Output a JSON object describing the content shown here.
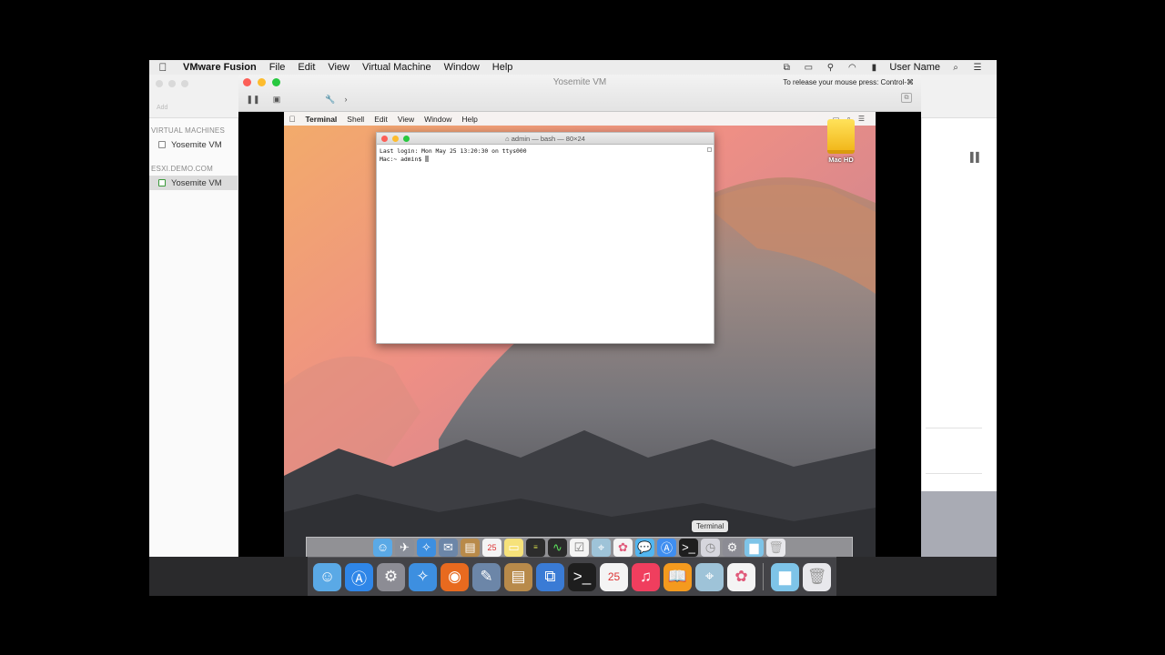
{
  "host_menubar": {
    "app": "VMware Fusion",
    "menus": [
      "File",
      "Edit",
      "View",
      "Virtual Machine",
      "Window",
      "Help"
    ],
    "user": "User Name"
  },
  "library": {
    "add_label": "Add",
    "sections": [
      {
        "heading": "VIRTUAL MACHINES",
        "item": "Yosemite VM"
      },
      {
        "heading": "ESXI.DEMO.COM",
        "item": "Yosemite VM"
      }
    ]
  },
  "vm_window": {
    "title": "Yosemite VM",
    "release_hint": "To release your mouse press: Control-⌘"
  },
  "guest_menubar": {
    "app": "Terminal",
    "menus": [
      "Shell",
      "Edit",
      "View",
      "Window",
      "Help"
    ]
  },
  "desktop": {
    "disk_label": "Mac HD"
  },
  "terminal": {
    "title": "admin — bash — 80×24",
    "line1": "Last login: Mon May 25 13:20:30 on ttys000",
    "prompt": "Mac:~ admin$ "
  },
  "guest_dock": {
    "tooltip": "Terminal"
  },
  "colors": {
    "accent_red": "#fc5f57",
    "accent_yellow": "#fdbc2e",
    "accent_green": "#28c840"
  }
}
